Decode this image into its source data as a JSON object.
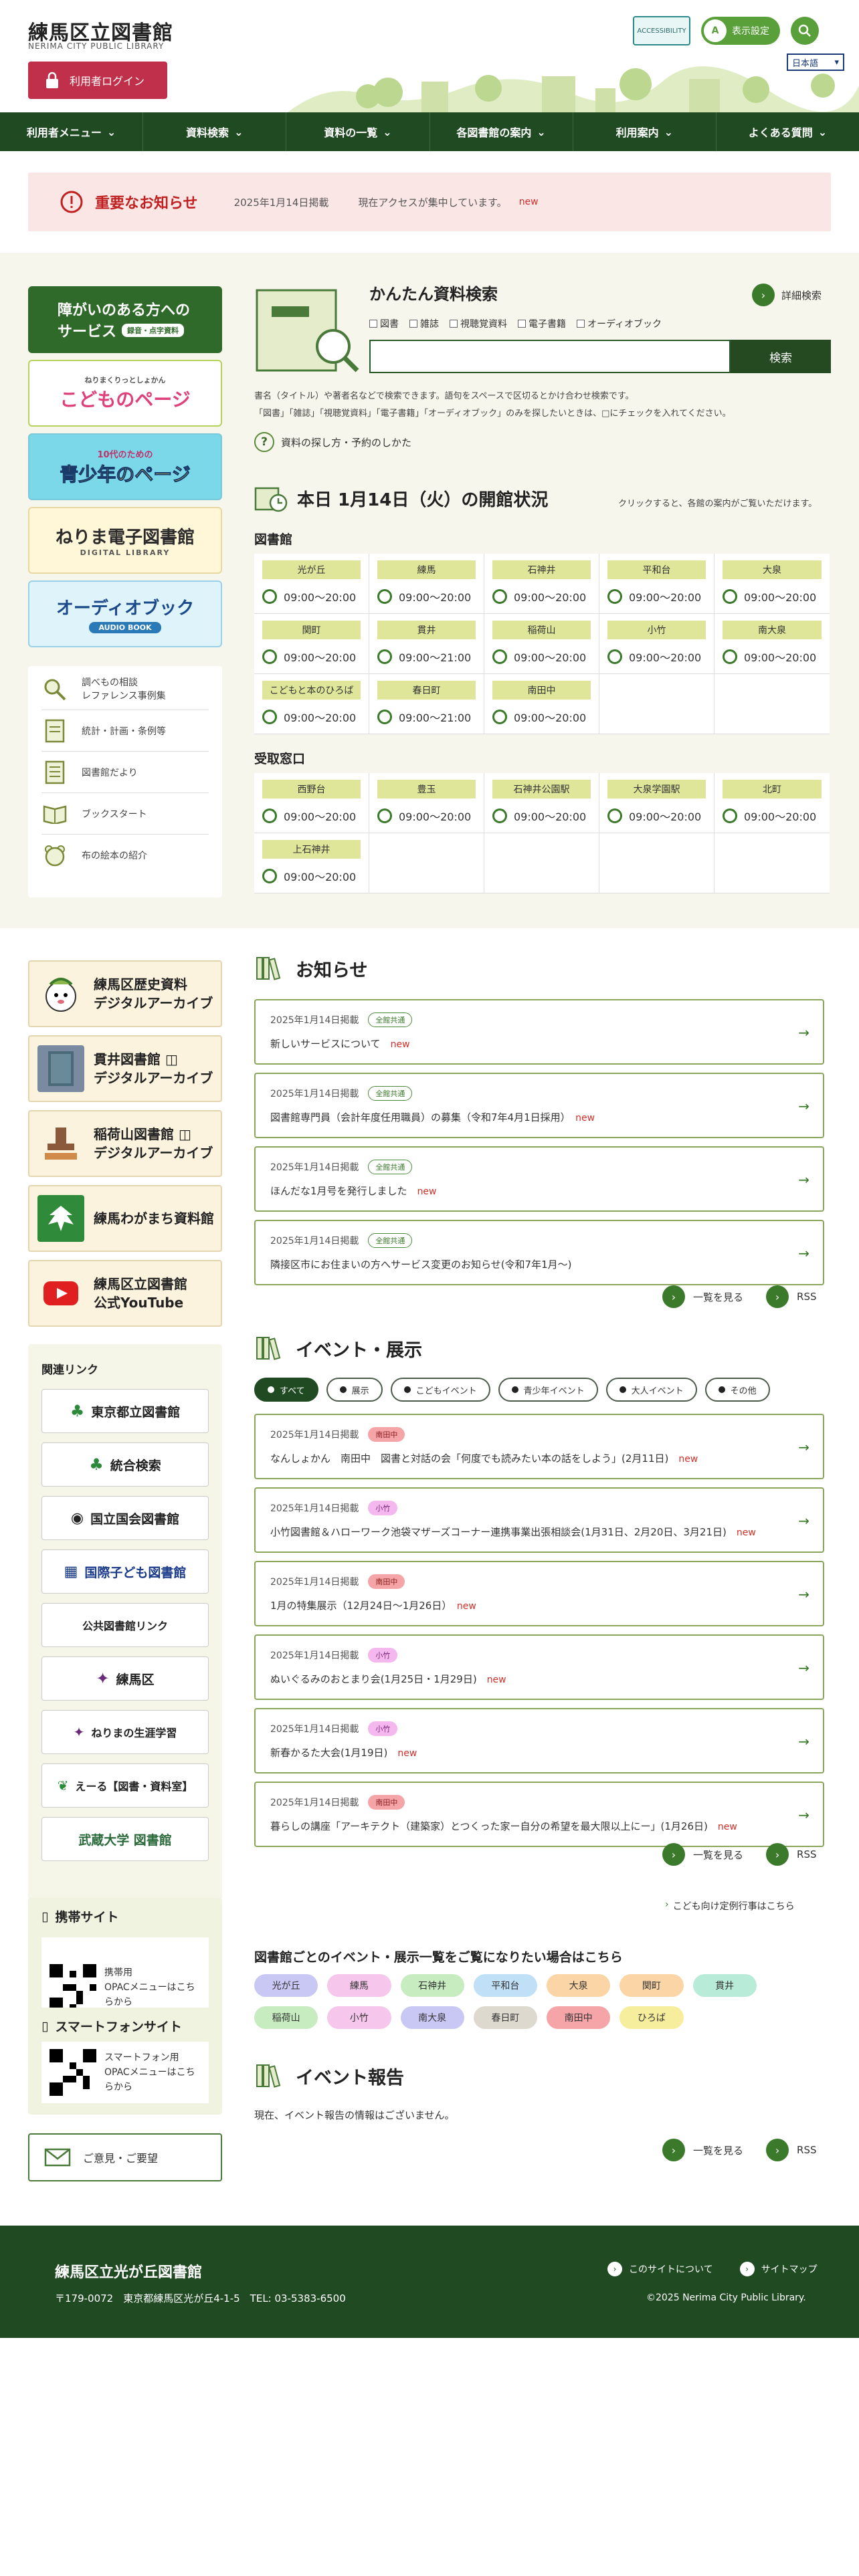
{
  "header": {
    "title": "練馬区立図書館",
    "subtitle": "NERIMA CITY PUBLIC LIBRARY",
    "login": "利用者ログイン",
    "display_setting": "表示設定",
    "display_icon": "A",
    "language": "日本語",
    "accessibility_icon": "ACCESSIBILITY"
  },
  "nav": [
    "利用者メニュー",
    "資料検索",
    "資料の一覧",
    "各図書館の案内",
    "利用案内",
    "よくある質問"
  ],
  "notice": {
    "title": "重要なお知らせ",
    "date": "2025年1月14日掲載",
    "message": "現在アクセスが集中しています。",
    "new": "new"
  },
  "banners": [
    {
      "line1": "障がいのある方への",
      "line2": "サービス",
      "tag": "録音・点字資料"
    },
    {
      "line1": "こどものページ",
      "tag": "ねりまくりっとしょかん"
    },
    {
      "line1": "青少年のページ",
      "tag": "10代のための"
    },
    {
      "line1": "ねりま電子図書館",
      "tag": "DIGITAL LIBRARY"
    },
    {
      "line1": "オーディオブック",
      "tag": "AUDIO BOOK"
    }
  ],
  "sidelinks": [
    "調べもの相談\nレファレンス事例集",
    "統計・計画・条例等",
    "図書館だより",
    "ブックスタート",
    "布の絵本の紹介"
  ],
  "easy_search": {
    "title": "かんたん資料検索",
    "detail": "詳細検索",
    "checks": [
      "図書",
      "雑誌",
      "視聴覚資料",
      "電子書籍",
      "オーディオブック"
    ],
    "button": "検索",
    "help1": "書名（タイトル）や著者名などで検索できます。語句をスペースで区切るとかけ合わせ検索です。",
    "help2": "「図書」「雑誌」「視聴覚資料」「電子書籍」「オーディオブック」のみを探したいときは、□にチェックを入れてください。",
    "how": "資料の探し方・予約のしかた"
  },
  "open_status": {
    "title": "本日 1月14日（火）の開館状況",
    "note": "クリックすると、各館の案内がご覧いただけます。",
    "libraries_label": "図書館",
    "libraries": [
      {
        "name": "光が丘",
        "time": "09:00〜20:00"
      },
      {
        "name": "練馬",
        "time": "09:00〜20:00"
      },
      {
        "name": "石神井",
        "time": "09:00〜20:00"
      },
      {
        "name": "平和台",
        "time": "09:00〜20:00"
      },
      {
        "name": "大泉",
        "time": "09:00〜20:00"
      },
      {
        "name": "関町",
        "time": "09:00〜20:00"
      },
      {
        "name": "貫井",
        "time": "09:00〜21:00"
      },
      {
        "name": "稲荷山",
        "time": "09:00〜20:00"
      },
      {
        "name": "小竹",
        "time": "09:00〜20:00"
      },
      {
        "name": "南大泉",
        "time": "09:00〜20:00"
      },
      {
        "name": "こどもと本のひろば",
        "time": "09:00〜20:00"
      },
      {
        "name": "春日町",
        "time": "09:00〜21:00"
      },
      {
        "name": "南田中",
        "time": "09:00〜20:00"
      }
    ],
    "pickup_label": "受取窓口",
    "pickups": [
      {
        "name": "西野台",
        "time": "09:00〜20:00"
      },
      {
        "name": "豊玉",
        "time": "09:00〜20:00"
      },
      {
        "name": "石神井公園駅",
        "time": "09:00〜20:00"
      },
      {
        "name": "大泉学園駅",
        "time": "09:00〜20:00"
      },
      {
        "name": "北町",
        "time": "09:00〜20:00"
      },
      {
        "name": "上石神井",
        "time": "09:00〜20:00"
      }
    ]
  },
  "archives": [
    {
      "l1": "練馬区歴史資料",
      "l2": "デジタルアーカイブ"
    },
    {
      "l1": "貫井図書館 ◫",
      "l2": "デジタルアーカイブ"
    },
    {
      "l1": "稲荷山図書館 ◫",
      "l2": "デジタルアーカイブ"
    },
    {
      "l1": "練馬わがまち資料館",
      "l2": ""
    },
    {
      "l1": "練馬区立図書館",
      "l2": "公式YouTube"
    }
  ],
  "related": {
    "title": "関連リンク",
    "items": [
      "東京都立図書館",
      "統合検索",
      "国立国会図書館",
      "国際子ども図書館",
      "公共図書館リンク",
      "練馬区",
      "ねりまの生涯学習",
      "えーる【図書・資料室】",
      "武蔵大学 図書館"
    ]
  },
  "mobile": {
    "title": "携帯サイト",
    "text": "携帯用\nOPACメニューはこちらから"
  },
  "smart": {
    "title": "スマートフォンサイト",
    "text": "スマートフォン用\nOPACメニューはこちらから"
  },
  "opinion": "ご意見・ご要望",
  "news": {
    "title": "お知らせ",
    "items": [
      {
        "date": "2025年1月14日掲載",
        "tag": "全館共通",
        "text": "新しいサービスについて",
        "new": "new"
      },
      {
        "date": "2025年1月14日掲載",
        "tag": "全館共通",
        "text": "図書館専門員（会計年度任用職員）の募集（令和7年4月1日採用）",
        "new": "new"
      },
      {
        "date": "2025年1月14日掲載",
        "tag": "全館共通",
        "text": "ほんだな1月号を発行しました",
        "new": "new"
      },
      {
        "date": "2025年1月14日掲載",
        "tag": "全館共通",
        "text": "隣接区市にお住まいの方へサービス変更のお知らせ(令和7年1月〜)",
        "new": ""
      }
    ],
    "more": "一覧を見る",
    "rss": "RSS"
  },
  "events": {
    "title": "イベント・展示",
    "filters": [
      "すべて",
      "展示",
      "こどもイベント",
      "青少年イベント",
      "大人イベント",
      "その他"
    ],
    "items": [
      {
        "date": "2025年1月14日掲載",
        "tag": "南田中",
        "tagtype": "p",
        "text": "なんしょかん　南田中　図書と対話の会「何度でも読みたい本の話をしよう」(2月11日)",
        "new": "new"
      },
      {
        "date": "2025年1月14日掲載",
        "tag": "小竹",
        "tagtype": "v",
        "text": "小竹図書館＆ハローワーク池袋マザーズコーナー連携事業出張相談会(1月31日、2月20日、3月21日)",
        "new": "new"
      },
      {
        "date": "2025年1月14日掲載",
        "tag": "南田中",
        "tagtype": "p",
        "text": "1月の特集展示（12月24日〜1月26日）",
        "new": "new"
      },
      {
        "date": "2025年1月14日掲載",
        "tag": "小竹",
        "tagtype": "v",
        "text": "ぬいぐるみのおとまり会(1月25日・1月29日)",
        "new": "new"
      },
      {
        "date": "2025年1月14日掲載",
        "tag": "小竹",
        "tagtype": "v",
        "text": "新春かるた大会(1月19日)",
        "new": "new"
      },
      {
        "date": "2025年1月14日掲載",
        "tag": "南田中",
        "tagtype": "p",
        "text": "暮らしの講座「アーキテクト（建築家）とつくった家ー自分の希望を最大限以上にー」(1月26日)",
        "new": "new"
      }
    ],
    "more": "一覧を見る",
    "rss": "RSS",
    "child_link": "こども向け定例行事はこちら",
    "by_lib_title": "図書館ごとのイベント・展示一覧をご覧になりたい場合はこちら",
    "libs": [
      {
        "name": "光が丘",
        "color": "#c9c8f4"
      },
      {
        "name": "練馬",
        "color": "#f6c6ec"
      },
      {
        "name": "石神井",
        "color": "#c6ecc0"
      },
      {
        "name": "平和台",
        "color": "#bfe0f6"
      },
      {
        "name": "大泉",
        "color": "#fbd5a6"
      },
      {
        "name": "関町",
        "color": "#fbd5a6"
      },
      {
        "name": "貫井",
        "color": "#b8ecd9"
      },
      {
        "name": "",
        "color": ""
      },
      {
        "name": "稲荷山",
        "color": "#c6ecc0"
      },
      {
        "name": "小竹",
        "color": "#f6c6ec"
      },
      {
        "name": "南大泉",
        "color": "#c9c8f4"
      },
      {
        "name": "春日町",
        "color": "#ddd9cf"
      },
      {
        "name": "南田中",
        "color": "#f5a5a8"
      },
      {
        "name": "ひろば",
        "color": "#f6ee9c"
      }
    ]
  },
  "reports": {
    "title": "イベント報告",
    "none": "現在、イベント報告の情報はございません。",
    "more": "一覧を見る",
    "rss": "RSS"
  },
  "footer": {
    "name": "練馬区立光が丘図書館",
    "addr": "〒179-0072　東京都練馬区光が丘4-1-5　TEL: 03-5383-6500",
    "about": "このサイトについて",
    "sitemap": "サイトマップ",
    "copy": "©2025 Nerima City Public Library."
  }
}
